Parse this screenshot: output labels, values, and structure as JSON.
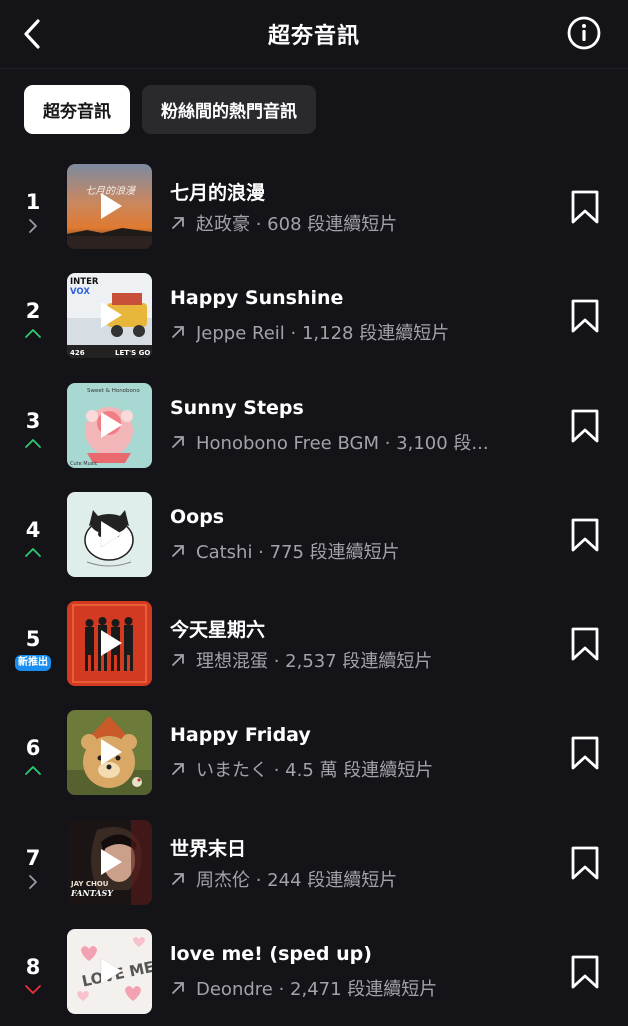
{
  "header": {
    "title": "超夯音訊",
    "back_icon": "chevron-left-icon",
    "info_icon": "info-icon"
  },
  "tabs": [
    {
      "label": "超夯音訊",
      "active": true
    },
    {
      "label": "粉絲間的熱門音訊",
      "active": false
    }
  ],
  "colors": {
    "background": "#131318",
    "trend_up": "#2ec971",
    "trend_down": "#e8323c",
    "trend_same": "#9a9aa0",
    "new_badge": "#1a8ef0"
  },
  "songs": [
    {
      "rank": "1",
      "trend": "same",
      "title": "七月的浪漫",
      "artist": "赵政豪",
      "uses": "608 段連續短片",
      "meta": "赵政豪 · 608 段連續短片"
    },
    {
      "rank": "2",
      "trend": "up",
      "title": "Happy Sunshine",
      "artist": "Jeppe Reil",
      "uses": "1,128 段連續短片",
      "meta": "Jeppe Reil · 1,128 段連續短片",
      "cover_text": [
        "INTER",
        "VOX",
        "426",
        "LET'S GO"
      ]
    },
    {
      "rank": "3",
      "trend": "up",
      "title": "Sunny Steps",
      "artist": "Honobono Free BGM",
      "uses": "3,100 段...",
      "meta": "Honobono Free BGM · 3,100 段...",
      "cover_text": [
        "Sweet & Honobono",
        "Cute Music"
      ]
    },
    {
      "rank": "4",
      "trend": "up",
      "title": "Oops",
      "artist": "Catshi",
      "uses": "775 段連續短片",
      "meta": "Catshi · 775 段連續短片"
    },
    {
      "rank": "5",
      "trend": "new",
      "trend_label": "新推出",
      "title": "今天星期六",
      "artist": "理想混蛋",
      "uses": "2,537 段連續短片",
      "meta": "理想混蛋 · 2,537 段連續短片"
    },
    {
      "rank": "6",
      "trend": "up",
      "title": "Happy Friday",
      "artist": "いまたく",
      "uses": "4.5 萬 段連續短片",
      "meta": "いまたく · 4.5 萬 段連續短片"
    },
    {
      "rank": "7",
      "trend": "same",
      "title": "世界末日",
      "artist": "周杰伦",
      "uses": "244 段連續短片",
      "meta": "周杰伦 · 244 段連續短片",
      "cover_text": [
        "JAY CHOU",
        "FANTASY"
      ]
    },
    {
      "rank": "8",
      "trend": "down",
      "title": "love me! (sped up)",
      "artist": "Deondre",
      "uses": "2,471 段連續短片",
      "meta": "Deondre · 2,471 段連續短片",
      "cover_text": [
        "LOVE ME!"
      ]
    }
  ]
}
